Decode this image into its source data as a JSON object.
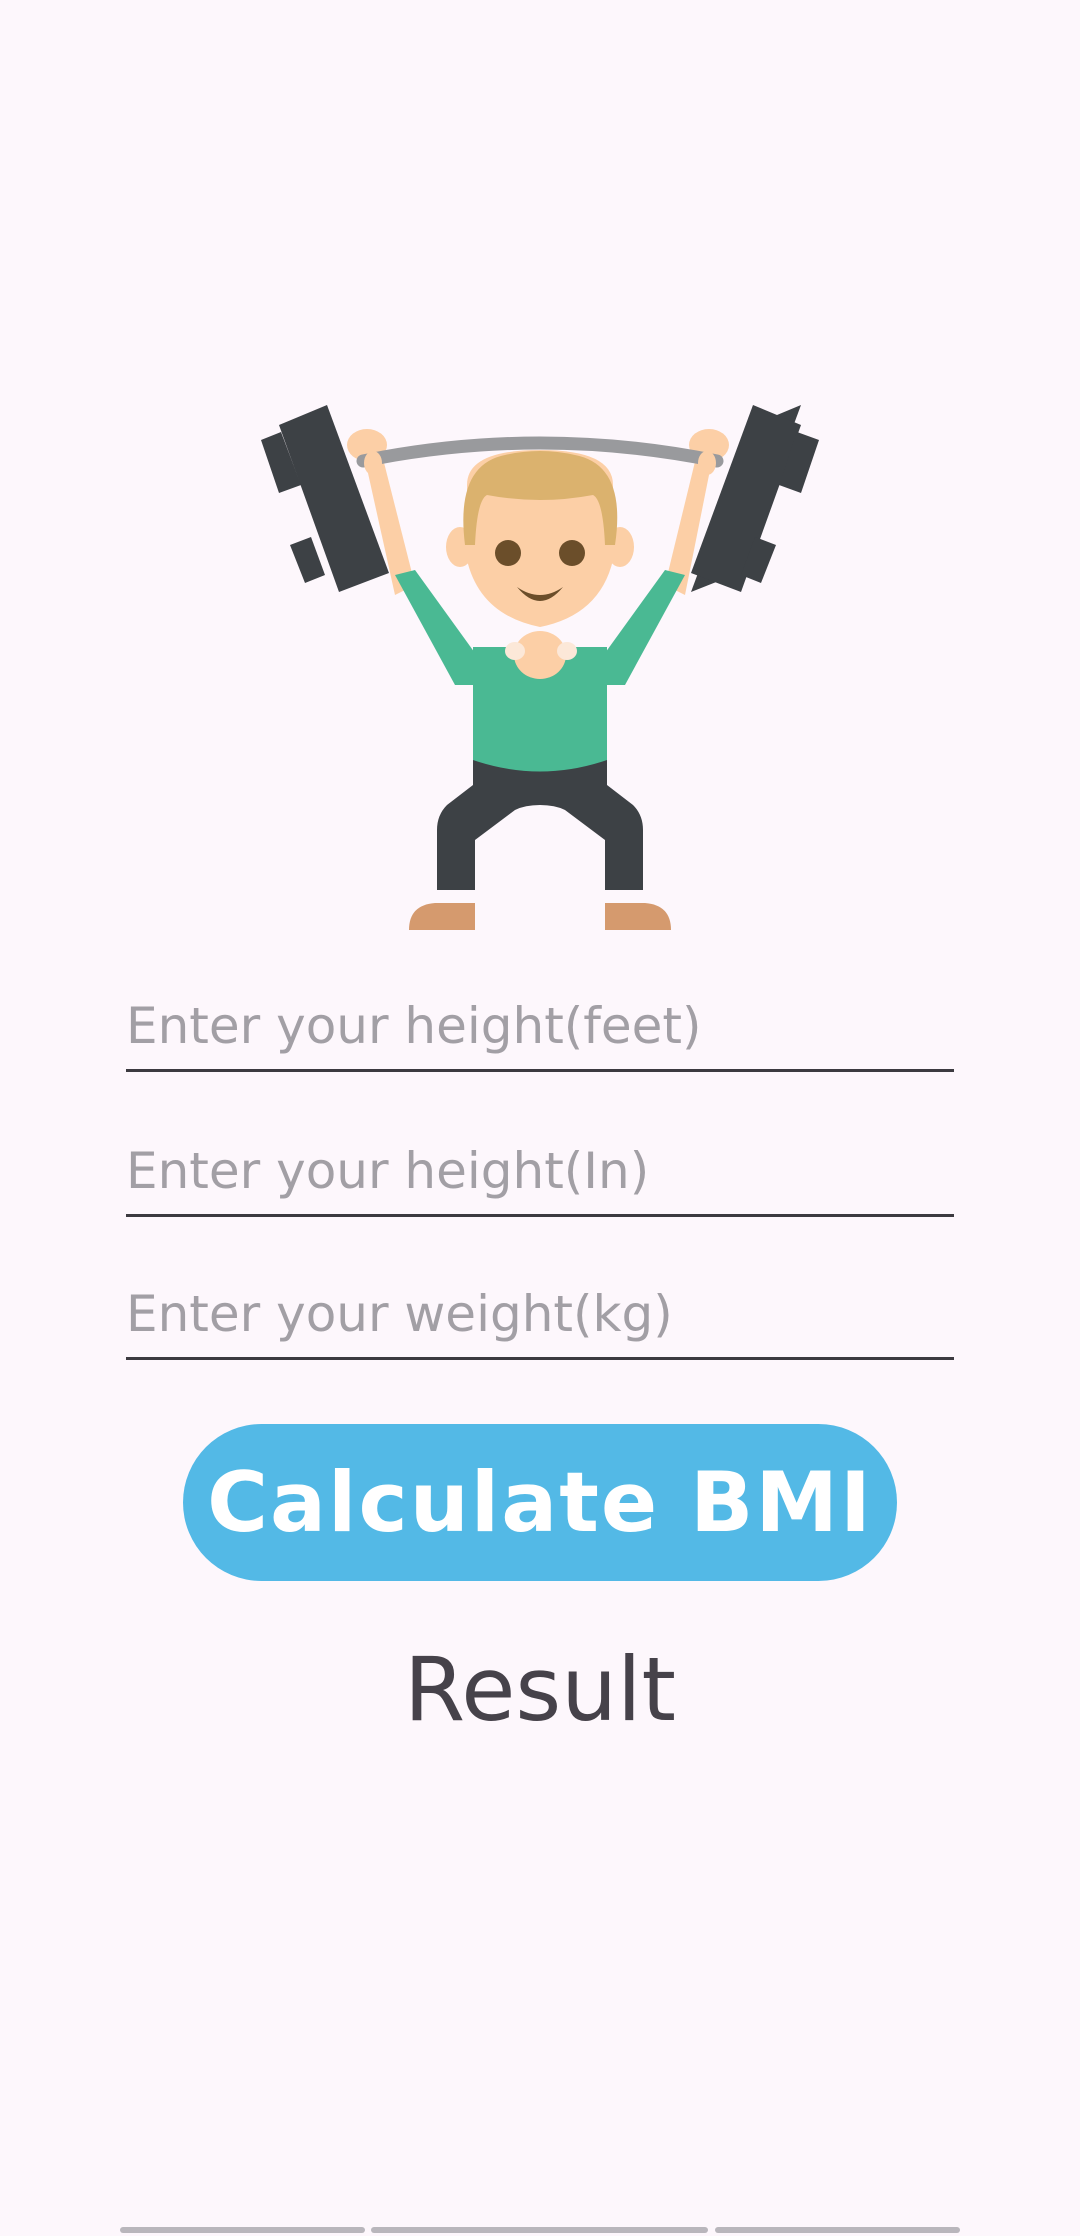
{
  "hero": {
    "icon": "weight-lifter-illustration"
  },
  "form": {
    "height_feet": {
      "placeholder": "Enter your height(feet)",
      "value": ""
    },
    "height_inches": {
      "placeholder": "Enter your height(In)",
      "value": ""
    },
    "weight_kg": {
      "placeholder": "Enter your weight(kg)",
      "value": ""
    }
  },
  "actions": {
    "calculate_label": "Calculate BMI"
  },
  "result": {
    "text": "Result"
  },
  "colors": {
    "background": "#FDF7FC",
    "button": "#53B9E6",
    "button_text": "#FFFFFF",
    "input_underline": "#3C3A40",
    "placeholder": "#A29FA5",
    "result_text": "#46424A"
  }
}
